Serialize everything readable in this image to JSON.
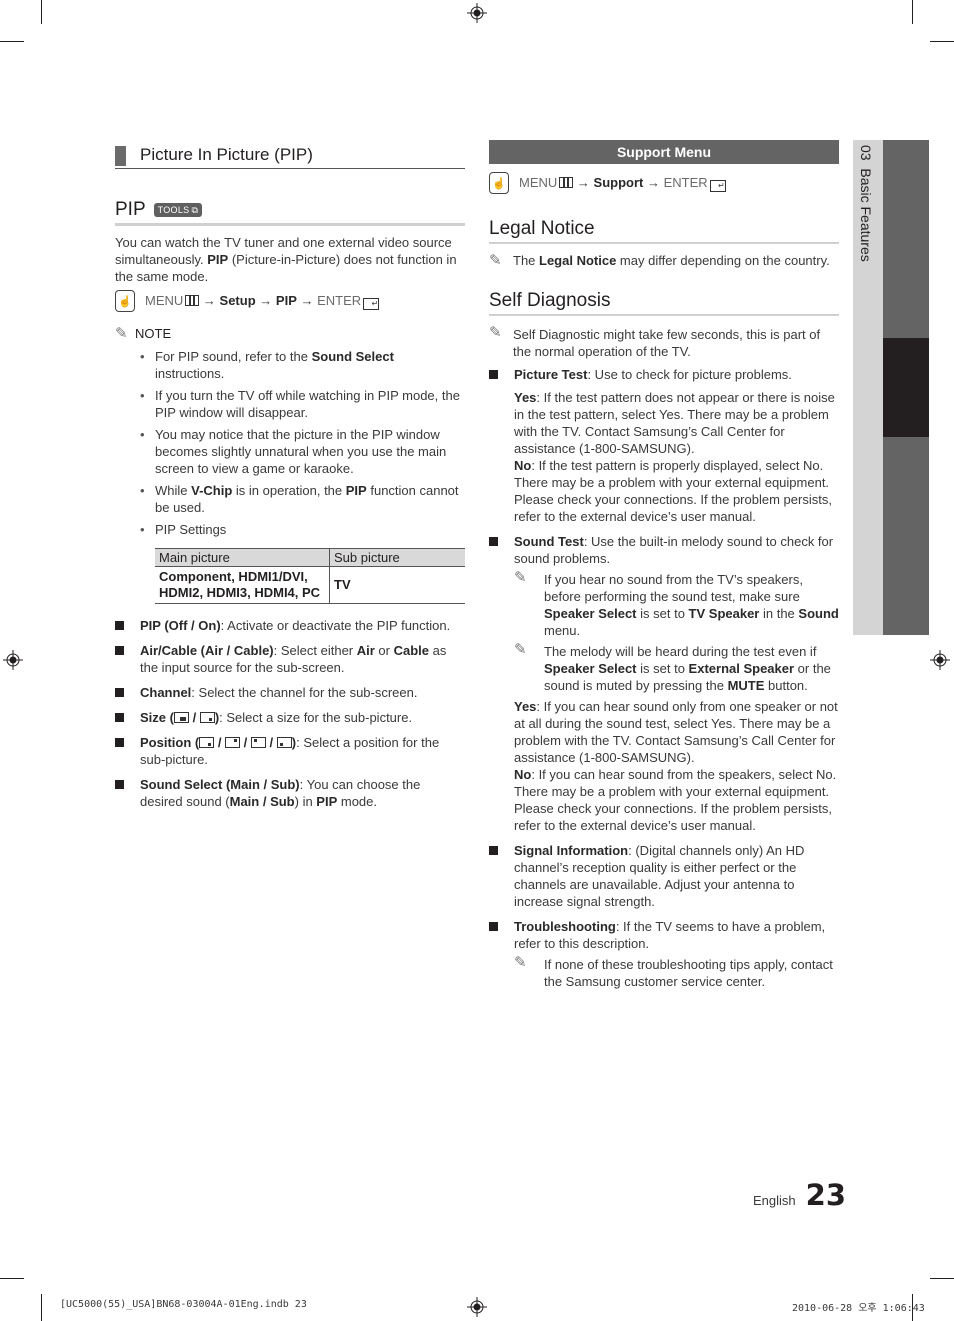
{
  "sidebar_tab": {
    "chapter": "03",
    "label": "Basic Features"
  },
  "left": {
    "section_title": "Picture In Picture (PIP)",
    "pip_heading": "PIP",
    "tools_badge": "TOOLS",
    "intro": {
      "before": "You can watch the TV tuner and one external video source simultaneously. ",
      "bold": "PIP",
      "after": " (Picture-in-Picture) does not function in the same mode."
    },
    "menu_path": {
      "menu": "MENU",
      "arrow": "→",
      "step1": "Setup",
      "step2": "PIP",
      "enter": "ENTER"
    },
    "note_label": "NOTE",
    "notes": [
      {
        "pre": "For PIP sound, refer to the ",
        "bold": "Sound Select",
        "post": " instructions."
      },
      {
        "pre": "If you turn the TV off while watching in PIP mode, the PIP window will disappear.",
        "bold": "",
        "post": ""
      },
      {
        "pre": "You may notice that the picture in the PIP window becomes slightly unnatural when you use the main screen to view a game or karaoke.",
        "bold": "",
        "post": ""
      },
      {
        "pre": "While ",
        "bold": "V-Chip",
        "mid": " is in operation, the ",
        "bold2": "PIP",
        "post": " function cannot be used."
      },
      {
        "pre": "PIP Settings",
        "bold": "",
        "post": ""
      }
    ],
    "table": {
      "headers": [
        "Main picture",
        "Sub picture"
      ],
      "rows": [
        [
          "Component, HDMI1/DVI, HDMI2, HDMI3, HDMI4, PC",
          "TV"
        ]
      ]
    },
    "items": [
      {
        "bold": "PIP (Off / On)",
        "text": ": Activate or deactivate the PIP function."
      },
      {
        "bold": "Air/Cable (Air / Cable)",
        "text": ": Select either ",
        "bold2": "Air",
        "text2": " or ",
        "bold3": "Cable",
        "text3": " as the input source for the sub-screen."
      },
      {
        "bold": "Channel",
        "text": ": Select the channel for the sub-screen."
      },
      {
        "bold": "Size (",
        "sep": " / ",
        "close": ")",
        "text": ": Select a size for the sub-picture."
      },
      {
        "bold": "Position (",
        "sep": " / ",
        "close": ")",
        "text": ": Select a position for the sub-picture."
      },
      {
        "bold": "Sound Select (Main / Sub)",
        "text": ": You can choose the desired sound (",
        "bold2": "Main / Sub",
        "text2": ") in ",
        "bold3": "PIP",
        "text3": " mode."
      }
    ]
  },
  "right": {
    "support_bar": "Support Menu",
    "menu_path": {
      "menu": "MENU",
      "arrow": "→",
      "step1": "Support",
      "enter": "ENTER"
    },
    "legal_title": "Legal Notice",
    "legal_note": {
      "pre": "The ",
      "bold": "Legal Notice",
      "post": " may differ depending on the country."
    },
    "diag_title": "Self Diagnosis",
    "diag_note": "Self Diagnostic might take few seconds, this is part of the normal operation of the TV.",
    "picture_test": {
      "bold": "Picture Test",
      "text": ": Use to check for picture problems.",
      "yes_b": "Yes",
      "yes": ": If the test pattern does not appear or there is noise in the test pattern, select Yes. There may be a problem with the TV. Contact Samsung’s Call Center for assistance (1-800-SAMSUNG).",
      "no_b": "No",
      "no": ": If the test pattern is properly displayed, select No. There may be a problem with your external equipment. Please check your connections. If the problem persists, refer to the external device’s user manual."
    },
    "sound_test": {
      "bold": "Sound Test",
      "text": ": Use the built-in melody sound to check for sound problems.",
      "note1": {
        "a": "If you hear no sound from the TV’s speakers, before performing the sound test, make sure ",
        "b1": "Speaker Select",
        "c": " is set to ",
        "b2": "TV Speaker",
        "d": " in the ",
        "b3": "Sound",
        "e": " menu."
      },
      "note2": {
        "a": "The melody will be heard during the test even if ",
        "b1": "Speaker Select",
        "c": " is set to ",
        "b2": "External Speaker",
        "d": " or the sound is muted by pressing the ",
        "b3": "MUTE",
        "e": " button."
      },
      "yes_b": "Yes",
      "yes": ": If you can hear sound only from one speaker or not at all during the sound test, select Yes. There may be a problem with the TV. Contact Samsung’s Call Center for assistance (1-800-SAMSUNG).",
      "no_b": "No",
      "no": ": If you can hear sound from the speakers, select No. There may be a problem with your external equipment. Please check your connections. If the problem persists, refer to the external device’s user manual."
    },
    "signal_info": {
      "bold": "Signal Information",
      "text": ": (Digital channels only) An HD channel’s reception quality is either perfect or the channels are unavailable. Adjust your antenna to increase signal strength."
    },
    "troubleshooting": {
      "bold": "Troubleshooting",
      "text": ": If the TV seems to have a problem, refer to this description.",
      "note": "If none of these troubleshooting tips apply, contact the Samsung customer service center."
    }
  },
  "footer": {
    "language": "English",
    "page_number": "23",
    "slug_left": "[UC5000(55)_USA]BN68-03004A-01Eng.indb   23",
    "slug_right": "2010-06-28   오후 1:06:43"
  }
}
